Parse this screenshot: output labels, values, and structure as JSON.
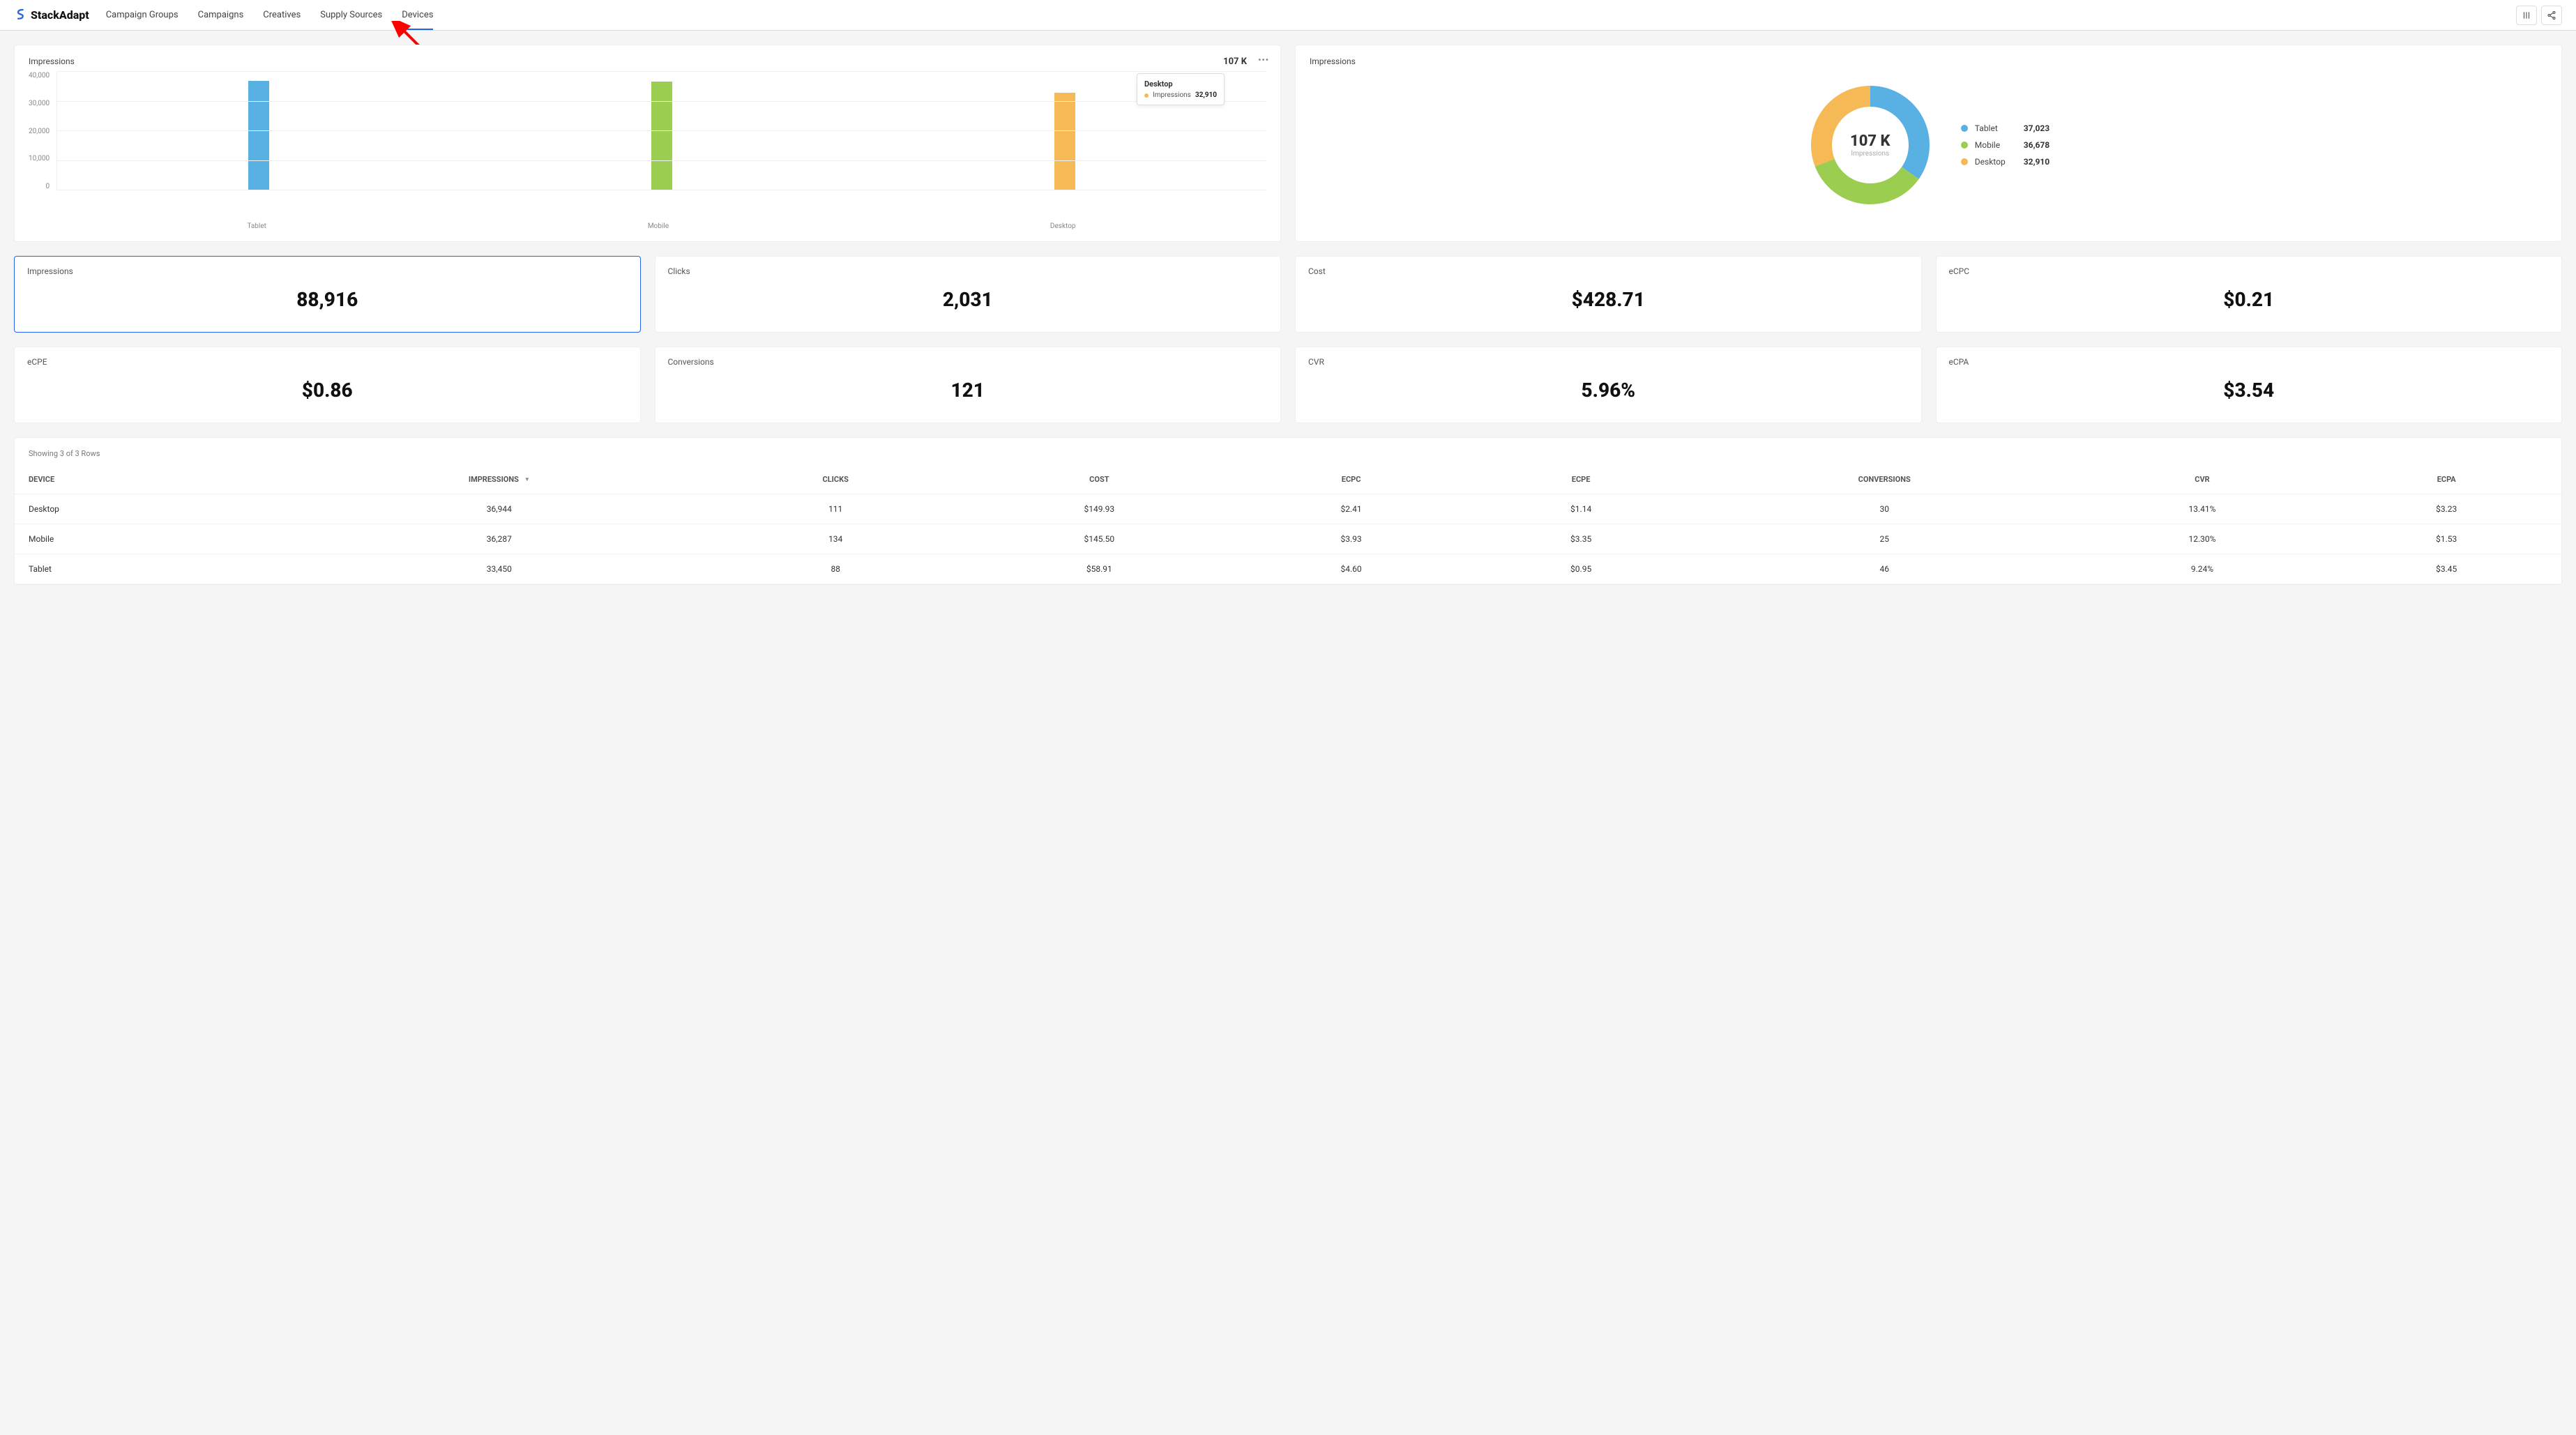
{
  "brand": "StackAdapt",
  "nav": {
    "items": [
      "Campaign Groups",
      "Campaigns",
      "Creatives",
      "Supply Sources",
      "Devices"
    ],
    "active_index": 4
  },
  "colors": {
    "tablet": "#58b0e3",
    "mobile": "#9acd50",
    "desktop": "#f5b955",
    "accent": "#2563eb"
  },
  "chart_data": [
    {
      "type": "bar",
      "title": "Impressions",
      "total_label": "107 K",
      "categories": [
        "Tablet",
        "Mobile",
        "Desktop"
      ],
      "values": [
        37023,
        36678,
        32910
      ],
      "colors": [
        "#58b0e3",
        "#9acd50",
        "#f5b955"
      ],
      "ylabel": "",
      "xlabel": "",
      "ylim": [
        0,
        40000
      ],
      "yticks": [
        0,
        10000,
        20000,
        30000,
        40000
      ],
      "ytick_labels": [
        "0",
        "10,000",
        "20,000",
        "30,000",
        "40,000"
      ],
      "tooltip": {
        "category": "Desktop",
        "metric": "Impressions",
        "value": "32,910",
        "color": "#f5b955"
      }
    },
    {
      "type": "pie",
      "title": "Impressions",
      "center_value": "107 K",
      "center_sub": "Impressions",
      "series": [
        {
          "name": "Tablet",
          "value": 37023,
          "display": "37,023",
          "color": "#58b0e3"
        },
        {
          "name": "Mobile",
          "value": 36678,
          "display": "36,678",
          "color": "#9acd50"
        },
        {
          "name": "Desktop",
          "value": 32910,
          "display": "32,910",
          "color": "#f5b955"
        }
      ]
    }
  ],
  "metrics_row1": [
    {
      "label": "Impressions",
      "value": "88,916",
      "selected": true
    },
    {
      "label": "Clicks",
      "value": "2,031"
    },
    {
      "label": "Cost",
      "value": "$428.71"
    },
    {
      "label": "eCPC",
      "value": "$0.21"
    }
  ],
  "metrics_row2": [
    {
      "label": "eCPE",
      "value": "$0.86"
    },
    {
      "label": "Conversions",
      "value": "121"
    },
    {
      "label": "CVR",
      "value": "5.96%"
    },
    {
      "label": "eCPA",
      "value": "$3.54"
    }
  ],
  "table": {
    "meta": "Showing 3 of 3 Rows",
    "columns": [
      "DEVICE",
      "IMPRESSIONS",
      "CLICKS",
      "COST",
      "ECPC",
      "ECPE",
      "CONVERSIONS",
      "CVR",
      "ECPA"
    ],
    "sorted_column_index": 1,
    "rows": [
      {
        "device": "Desktop",
        "impressions": "36,944",
        "clicks": "111",
        "cost": "$149.93",
        "ecpc": "$2.41",
        "ecpe": "$1.14",
        "conversions": "30",
        "cvr": "13.41%",
        "ecpa": "$3.23"
      },
      {
        "device": "Mobile",
        "impressions": "36,287",
        "clicks": "134",
        "cost": "$145.50",
        "ecpc": "$3.93",
        "ecpe": "$3.35",
        "conversions": "25",
        "cvr": "12.30%",
        "ecpa": "$1.53"
      },
      {
        "device": "Tablet",
        "impressions": "33,450",
        "clicks": "88",
        "cost": "$58.91",
        "ecpc": "$4.60",
        "ecpe": "$0.95",
        "conversions": "46",
        "cvr": "9.24%",
        "ecpa": "$3.45"
      }
    ]
  }
}
